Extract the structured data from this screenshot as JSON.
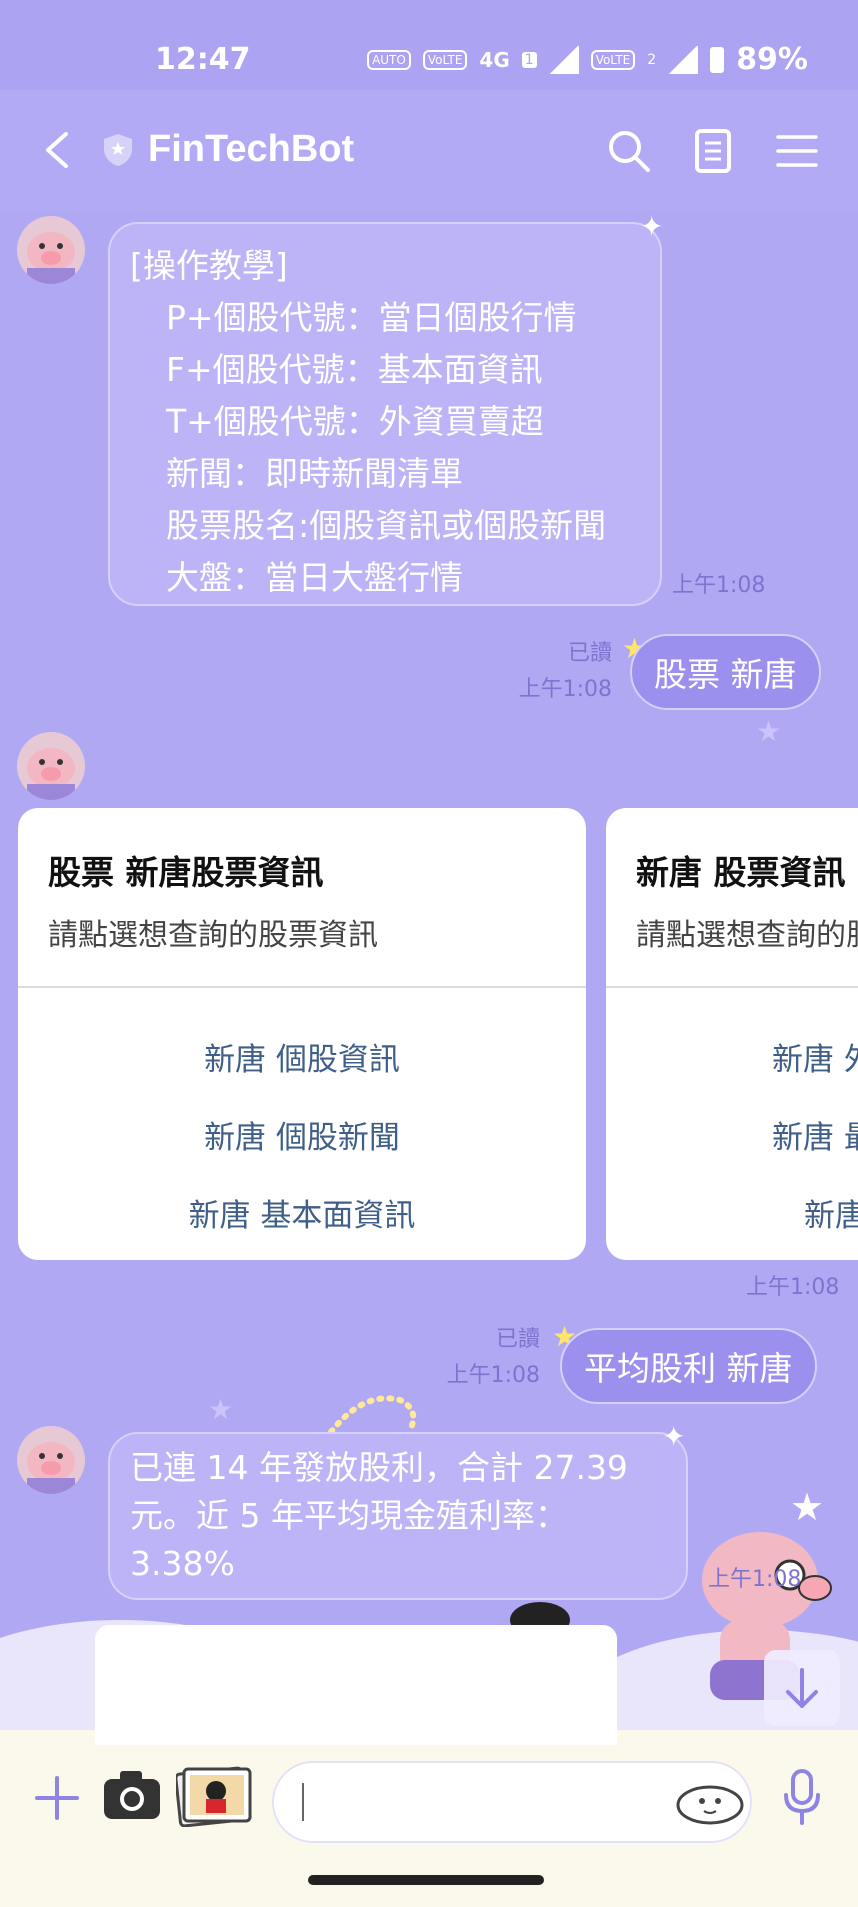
{
  "status_bar": {
    "time": "12:47",
    "battery": "89%",
    "network": "4G",
    "sim_badge": "1",
    "sim2_badge": "2"
  },
  "header": {
    "title": "FinTechBot"
  },
  "messages": {
    "bot_help": {
      "title_line": "[操作教學]",
      "lines": [
        "P+個股代號：當日個股行情",
        "F+個股代號：基本面資訊",
        "T+個股代號：外資買賣超",
        "新聞：即時新聞清單",
        "股票股名:個股資訊或個股新聞",
        "大盤：當日大盤行情"
      ],
      "time": "上午1:08"
    },
    "user_1": {
      "text": "股票 新唐",
      "read": "已讀",
      "time": "上午1:08"
    },
    "cards": [
      {
        "title": "股票 新唐股票資訊",
        "subtitle": "請點選想查詢的股票資訊",
        "actions": [
          "新唐 個股資訊",
          "新唐 個股新聞",
          "新唐 基本面資訊"
        ]
      },
      {
        "title": "新唐 股票資訊",
        "subtitle": "請點選想查詢的股",
        "actions": [
          "新唐 外",
          "新唐 最",
          "新唐"
        ]
      }
    ],
    "cards_time": "上午1:08",
    "user_2": {
      "text": "平均股利 新唐",
      "read": "已讀",
      "time": "上午1:08"
    },
    "bot_dividend": {
      "lines": [
        "已連 14 年發放股利，合計 27.39",
        "元。近 5 年平均現金殖利率：",
        "3.38%"
      ],
      "time": "上午1:08"
    }
  },
  "input": {
    "placeholder": ""
  },
  "colors": {
    "background": "#b1a8f4",
    "user_bubble": "#9c90ef",
    "bot_bubble": "#bcb4f7",
    "link": "#3f5f88"
  }
}
